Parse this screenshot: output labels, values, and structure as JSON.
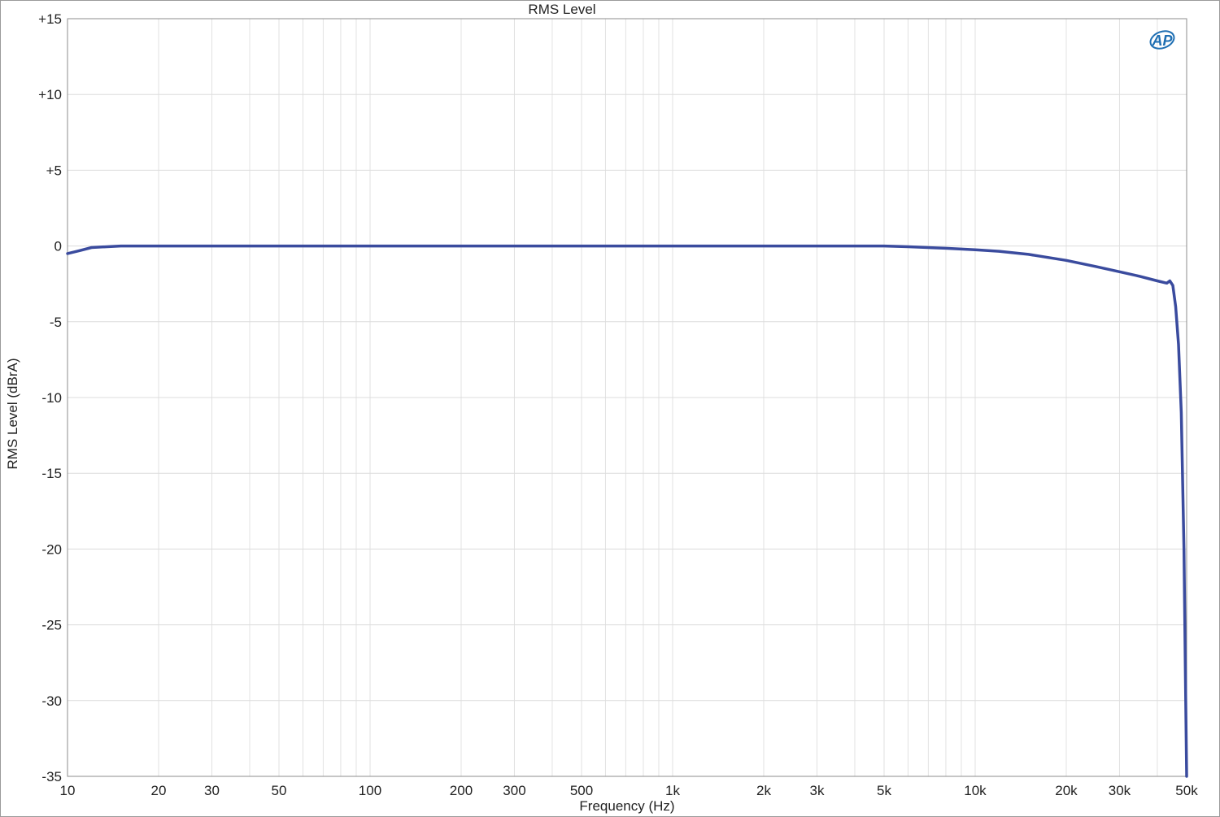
{
  "chart_data": {
    "type": "line",
    "title": "RMS Level",
    "xlabel": "Frequency (Hz)",
    "ylabel": "RMS Level (dBrA)",
    "x_scale": "log",
    "xlim": [
      10,
      50000
    ],
    "ylim": [
      -35,
      15
    ],
    "grid": true,
    "x_major_ticks": [
      {
        "value": 10,
        "label": "10"
      },
      {
        "value": 20,
        "label": "20"
      },
      {
        "value": 30,
        "label": "30"
      },
      {
        "value": 50,
        "label": "50"
      },
      {
        "value": 100,
        "label": "100"
      },
      {
        "value": 200,
        "label": "200"
      },
      {
        "value": 300,
        "label": "300"
      },
      {
        "value": 500,
        "label": "500"
      },
      {
        "value": 1000,
        "label": "1k"
      },
      {
        "value": 2000,
        "label": "2k"
      },
      {
        "value": 3000,
        "label": "3k"
      },
      {
        "value": 5000,
        "label": "5k"
      },
      {
        "value": 10000,
        "label": "10k"
      },
      {
        "value": 20000,
        "label": "20k"
      },
      {
        "value": 30000,
        "label": "30k"
      },
      {
        "value": 50000,
        "label": "50k"
      }
    ],
    "y_ticks": [
      {
        "value": 15,
        "label": "+15"
      },
      {
        "value": 10,
        "label": "+10"
      },
      {
        "value": 5,
        "label": "+5"
      },
      {
        "value": 0,
        "label": "0"
      },
      {
        "value": -5,
        "label": "-5"
      },
      {
        "value": -10,
        "label": "-10"
      },
      {
        "value": -15,
        "label": "-15"
      },
      {
        "value": -20,
        "label": "-20"
      },
      {
        "value": -25,
        "label": "-25"
      },
      {
        "value": -30,
        "label": "-30"
      },
      {
        "value": -35,
        "label": "-35"
      }
    ],
    "series": [
      {
        "color": "#3a4b9e",
        "points": [
          [
            10,
            -0.5
          ],
          [
            11,
            -0.3
          ],
          [
            12,
            -0.1
          ],
          [
            15,
            0.0
          ],
          [
            20,
            0.0
          ],
          [
            50,
            0.0
          ],
          [
            100,
            0.0
          ],
          [
            500,
            0.0
          ],
          [
            1000,
            0.0
          ],
          [
            2000,
            0.0
          ],
          [
            5000,
            0.0
          ],
          [
            6000,
            -0.05
          ],
          [
            8000,
            -0.15
          ],
          [
            10000,
            -0.25
          ],
          [
            12000,
            -0.35
          ],
          [
            15000,
            -0.55
          ],
          [
            20000,
            -0.95
          ],
          [
            25000,
            -1.35
          ],
          [
            30000,
            -1.7
          ],
          [
            35000,
            -2.0
          ],
          [
            40000,
            -2.3
          ],
          [
            43000,
            -2.45
          ],
          [
            44000,
            -2.3
          ],
          [
            45000,
            -2.6
          ],
          [
            46000,
            -4.0
          ],
          [
            47000,
            -6.5
          ],
          [
            48000,
            -11.0
          ],
          [
            49000,
            -20.0
          ],
          [
            49500,
            -28.0
          ],
          [
            50000,
            -35.0
          ]
        ]
      }
    ]
  },
  "logo": {
    "text": "AP",
    "color": "#1f6fb3"
  }
}
